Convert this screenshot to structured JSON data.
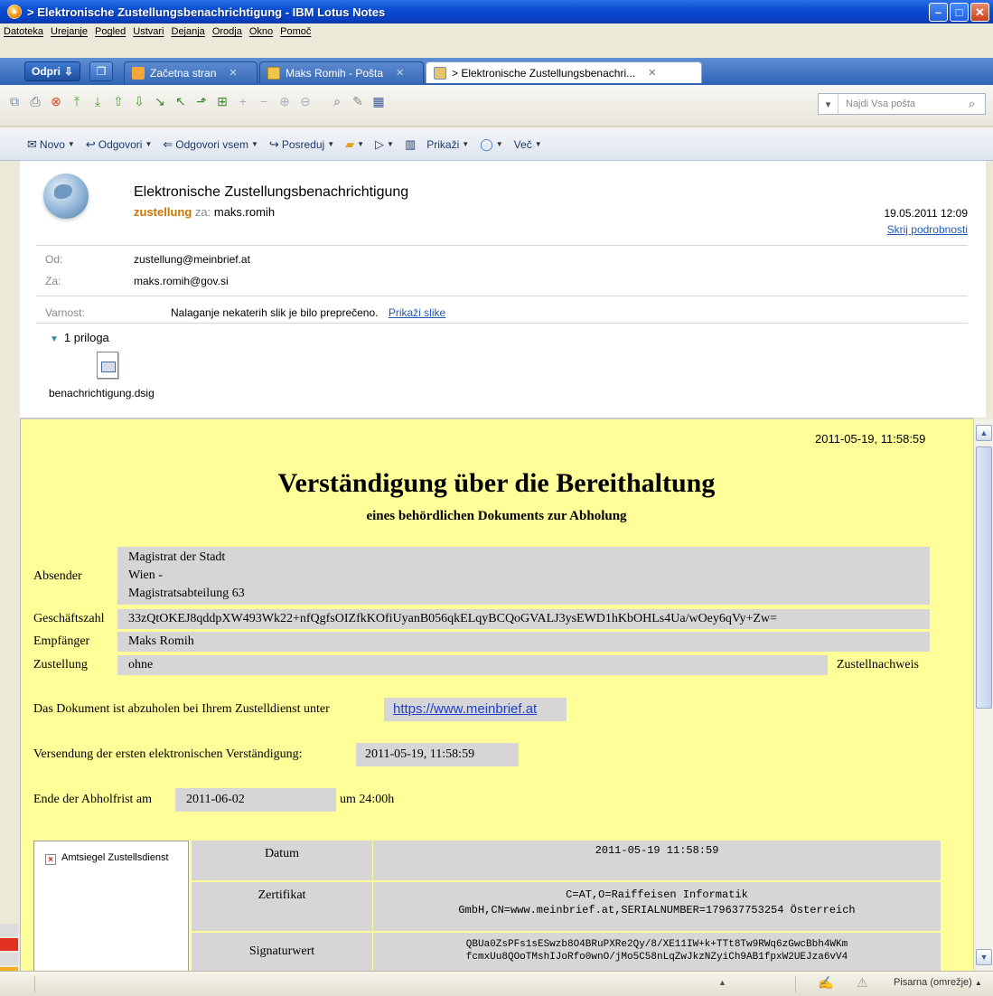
{
  "window": {
    "title": "> Elektronische Zustellungsbenachrichtigung - IBM Lotus Notes",
    "controls": [
      "minimize",
      "maximize",
      "close"
    ]
  },
  "menu": [
    "Datoteka",
    "Urejanje",
    "Pogled",
    "Ustvari",
    "Dejanja",
    "Orodja",
    "Okno",
    "Pomoč"
  ],
  "tabs": {
    "open_label": "Odpri",
    "items": [
      {
        "label": "Začetna stran",
        "icon": "home-icon"
      },
      {
        "label": "Maks Romih - Pošta",
        "icon": "mail-icon"
      },
      {
        "label": "> Elektronische Zustellungsbenachri...",
        "icon": "message-icon",
        "active": true
      }
    ]
  },
  "search": {
    "placeholder": "Najdi Vsa pošta"
  },
  "actions": [
    "Novo",
    "Odgovori",
    "Odgovori vsem",
    "Posreduj",
    "Prikaži",
    "Več"
  ],
  "header": {
    "subject": "Elektronische Zustellungsbenachrichtigung",
    "sender": "zustellung",
    "to_prefix": "za:",
    "to_name": "maks.romih",
    "date": "19.05.2011 12:09",
    "hide_details": "Skrij podrobnosti",
    "from_label": "Od:",
    "from_value": "zustellung@meinbrief.at",
    "to_label": "Za:",
    "to_value": "maks.romih@gov.si",
    "security_label": "Varnost:",
    "security_text": "Nalaganje nekaterih slik je bilo preprečeno.",
    "show_images": "Prikaži slike",
    "attachments_count": "1 priloga",
    "attachment_name": "benachrichtigung.dsig"
  },
  "document": {
    "timestamp": "2011-05-19, 11:58:59",
    "title": "Verständigung über die Bereithaltung",
    "subtitle": "eines behördlichen Dokuments zur Abholung",
    "absender_label": "Absender",
    "absender_lines": [
      "Magistrat der Stadt",
      "Wien -",
      "Magistratsabteilung 63"
    ],
    "geschaeftszahl_label": "Geschäftszahl",
    "geschaeftszahl_value": "33zQtOKEJ8qddpXW493Wk22+nfQgfsOIZfkKOfiUyanB056qkELqyBCQoGVALJ3ysEWD1hKbOHLs4Ua/wOey6qVy+Zw=",
    "empfaenger_label": "Empfänger",
    "empfaenger_value": "Maks Romih",
    "zustellung_label": "Zustellung",
    "zustellung_value": "ohne",
    "zustellnachweis": "Zustellnachweis",
    "abholen_text": "Das Dokument ist abzuholen bei Ihrem Zustelldienst unter",
    "abholen_link": "https://www.meinbrief.at",
    "versendung_label": "Versendung der ersten elektronischen Verständigung:",
    "versendung_value": "2011-05-19, 11:58:59",
    "ende_label": "Ende der Abholfrist am",
    "ende_value": "2011-06-02",
    "ende_suffix": "um 24:00h"
  },
  "signature": {
    "seal_label": "Amtsiegel Zustellsdienst",
    "rows": [
      {
        "label": "Datum",
        "value": "2011-05-19 11:58:59"
      },
      {
        "label": "Zertifikat",
        "value_lines": [
          "C=AT,O=Raiffeisen Informatik",
          "GmbH,CN=www.meinbrief.at,SERIALNUMBER=179637753254 Österreich"
        ]
      },
      {
        "label": "Signaturwert",
        "value_lines": [
          "QBUa0ZsPFs1sESwzb8O4BRuPXRe2Qy/8/XE11IW+k+TTt8Tw9RWq6zGwcBbh4WKm",
          "fcmxUu8QOoTMshIJoRfo0wnO/jMo5C58nLqZwJkzNZyiCh9AB1fpxW2UEJza6vV4"
        ]
      }
    ]
  },
  "status": {
    "location": "Pisarna (omrežje)"
  }
}
